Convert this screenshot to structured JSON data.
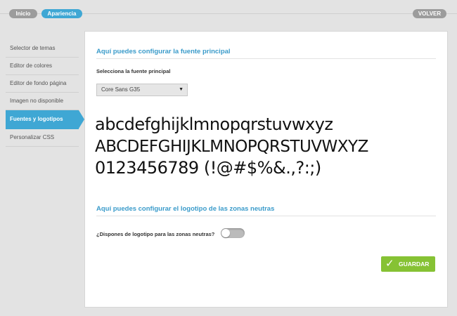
{
  "breadcrumb": {
    "home": "Inicio",
    "current": "Apariencia"
  },
  "back_label": "VOLVER",
  "sidebar": {
    "items": [
      {
        "label": "Selector de temas",
        "active": false
      },
      {
        "label": "Editor de colores",
        "active": false
      },
      {
        "label": "Editor de fondo página",
        "active": false
      },
      {
        "label": "Imagen no disponible",
        "active": false
      },
      {
        "label": "Fuentes y logotipos",
        "active": true
      },
      {
        "label": "Personalizar CSS",
        "active": false
      }
    ]
  },
  "font_section": {
    "title": "Aquí puedes configurar la fuente principal",
    "select_label": "Selecciona la fuente principal",
    "selected_font": "Core Sans G35",
    "sample_lower": "abcdefghijklmnopqrstuvwxyz",
    "sample_upper": "ABCDEFGHIJKLMNOPQRSTUVWXYZ",
    "sample_digits": "0123456789 (!@#$%&.,?:;)"
  },
  "logo_section": {
    "title": "Aquí puedes configurar el logotipo de las zonas neutras",
    "question": "¿Dispones de logotipo para las zonas neutras?",
    "toggle_on": false
  },
  "save_label": "GUARDAR",
  "icons": {
    "save": "check-icon",
    "select": "chevron-down-icon"
  },
  "colors": {
    "accent": "#3fa7d4",
    "save": "#86c234",
    "pill": "#9c9c9c"
  }
}
